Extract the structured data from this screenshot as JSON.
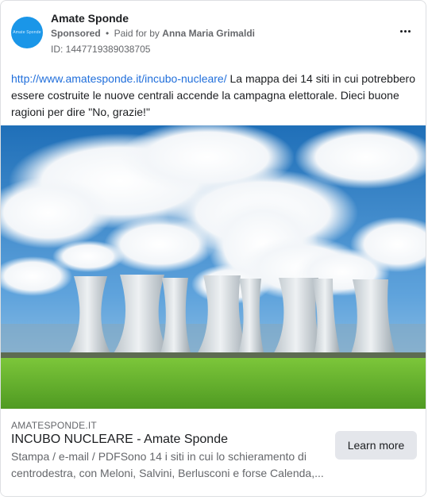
{
  "ad": {
    "page_name": "Amate Sponde",
    "avatar_text": "Amate Sponde",
    "sponsored_label": "Sponsored",
    "separator": "•",
    "paid_for_prefix": "Paid for by",
    "payer": "Anna Maria Grimaldi",
    "id_text": "ID: 1447719389038705",
    "more_icon": "more-horizontal-icon",
    "body_link": "http://www.amatesponde.it/incubo-nucleare/",
    "body_text": " La mappa dei 14 siti in cui potrebbero essere costruite le nuove centrali accende la campagna elettorale. Dieci buone ragioni per dire \"No, grazie!\"",
    "image_subject": "nuclear-power-plant-cooling-towers",
    "link_domain": "AMATESPONDE.IT",
    "link_title": "INCUBO NUCLEARE - Amate Sponde",
    "link_description": "Stampa / e-mail / PDFSono 14 i siti in cui lo schieramento di centrodestra, con Meloni, Salvini, Berlusconi e forse Calenda,...",
    "cta_label": "Learn more"
  },
  "colors": {
    "link_blue": "#216fdb",
    "avatar_blue": "#1a96e8",
    "sky_blue": "#2f7fc4",
    "grass_green": "#6bbd2f"
  }
}
